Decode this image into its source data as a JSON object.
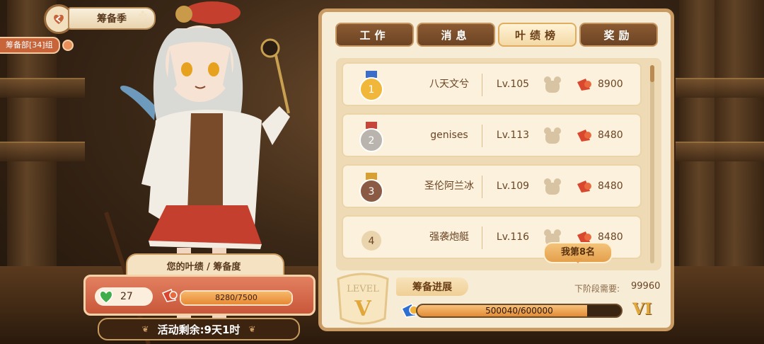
{
  "header": {
    "title": "筹备季",
    "group_tag": "筹备部[34]组"
  },
  "tabs": [
    {
      "label": "工作",
      "active": false
    },
    {
      "label": "消息",
      "active": false
    },
    {
      "label": "叶绩榜",
      "active": true
    },
    {
      "label": "奖励",
      "active": false
    }
  ],
  "ranking": [
    {
      "rank": "1",
      "name": "八天文兮",
      "level": "Lv.105",
      "points": "8900",
      "medal": "gold"
    },
    {
      "rank": "2",
      "name": "genises",
      "level": "Lv.113",
      "points": "8480",
      "medal": "silver"
    },
    {
      "rank": "3",
      "name": "圣伦阿兰冰",
      "level": "Lv.109",
      "points": "8480",
      "medal": "bronze"
    },
    {
      "rank": "4",
      "name": "强袭炮艇",
      "level": "Lv.116",
      "points": "8480",
      "medal": "none"
    }
  ],
  "my_rank_label": "我第8名",
  "player": {
    "score_title": "您的叶绩 / 筹备度",
    "hearts": "27",
    "score_text": "8280/7500",
    "score_fraction": 1.0,
    "remaining": "活动剩余:9天1时"
  },
  "progress": {
    "level_word": "LEVEL",
    "current_level": "V",
    "next_level": "VI",
    "label": "筹备进展",
    "need_label": "下阶段需要:",
    "need_value": "99960",
    "text": "500040/600000",
    "fraction": 0.8334
  },
  "colors": {
    "accent": "#c99a62",
    "tab_active": "#f3d9a6",
    "progress": "#e38b35",
    "heart": "#3fae4a"
  }
}
